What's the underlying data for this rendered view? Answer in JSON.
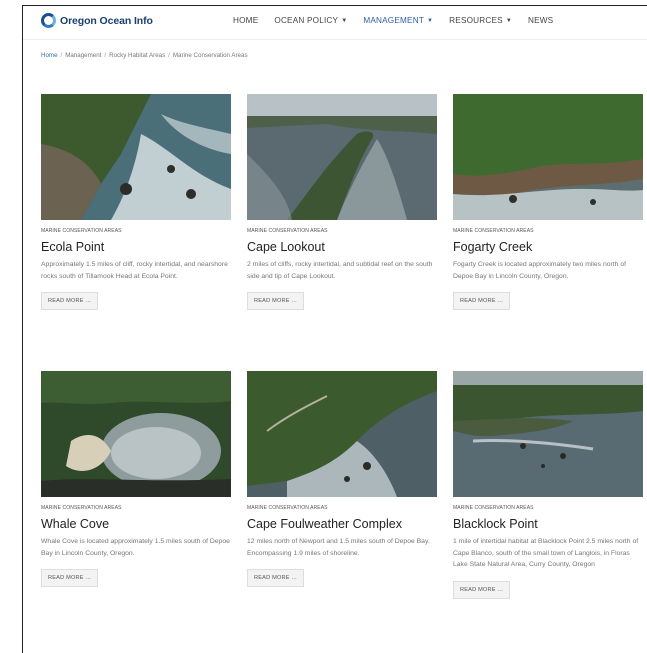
{
  "site": {
    "name": "Oregon Ocean Info"
  },
  "nav": [
    {
      "label": "HOME",
      "dropdown": false,
      "active": false
    },
    {
      "label": "OCEAN POLICY",
      "dropdown": true,
      "active": false
    },
    {
      "label": "MANAGEMENT",
      "dropdown": true,
      "active": true
    },
    {
      "label": "RESOURCES",
      "dropdown": true,
      "active": false
    },
    {
      "label": "NEWS",
      "dropdown": false,
      "active": false
    }
  ],
  "breadcrumb": [
    "Home",
    "Management",
    "Rocky Habitat Areas",
    "Marine Conservation Areas"
  ],
  "cards": [
    {
      "category": "MARINE CONSERVATION AREAS",
      "title": "Ecola Point",
      "desc": "Approximately 1.5 miles of cliff, rocky intertidal, and nearshore rocks south of Tillamook Head at Ecola Point.",
      "button": "READ MORE …"
    },
    {
      "category": "MARINE CONSERVATION AREAS",
      "title": "Cape Lookout",
      "desc": "2 miles of cliffs, rocky intertidal, and subtidal reef on the south side and tip of Cape Lookout.",
      "button": "READ MORE …"
    },
    {
      "category": "MARINE CONSERVATION AREAS",
      "title": "Fogarty Creek",
      "desc": "Fogarty Creek is located approximately two miles north of Depoe Bay in Lincoln County, Oregon.",
      "button": "READ MORE …"
    },
    {
      "category": "MARINE CONSERVATION AREAS",
      "title": "Whale Cove",
      "desc": "Whale Cove is located approximately 1.5 miles south of Depoe Bay in Lincoln County, Oregon.",
      "button": "READ MORE …"
    },
    {
      "category": "MARINE CONSERVATION AREAS",
      "title": "Cape Foulweather Complex",
      "desc": "12 miles north of Newport and 1.5 miles south of Depoe Bay. Encompassing 1.9 miles of shoreline.",
      "button": "READ MORE …"
    },
    {
      "category": "MARINE CONSERVATION AREAS",
      "title": "Blacklock Point",
      "desc": "1 mile of intertidal habitat at Blacklock Point 2.5 miles north of Cape Blanco, south of the small town of Langlois, in Floras Lake State Natural Area, Curry County, Oregon",
      "button": "READ MORE …"
    }
  ]
}
